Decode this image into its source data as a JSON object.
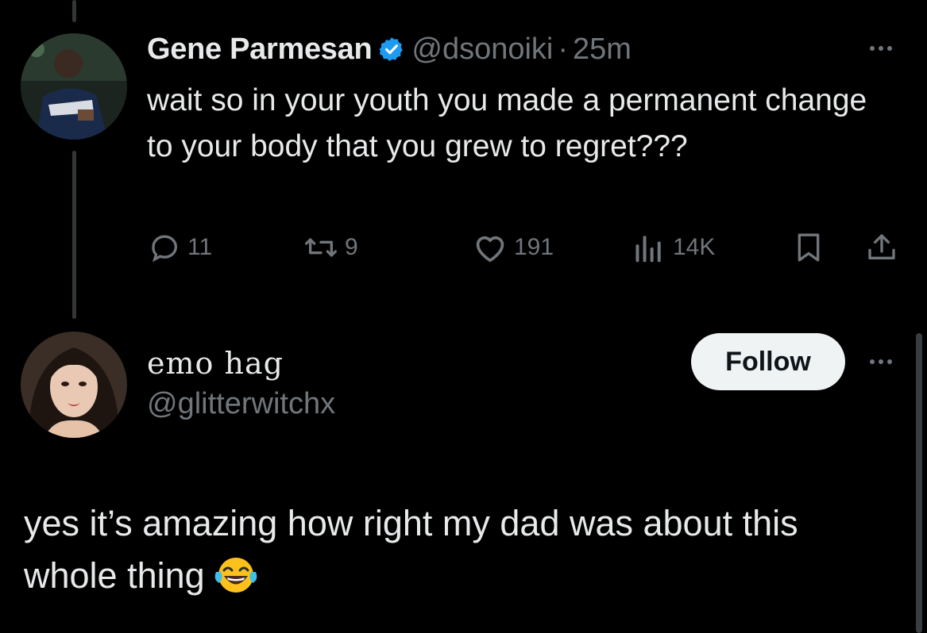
{
  "parent_tweet": {
    "display_name": "Gene Parmesan",
    "handle": "@dsonoiki",
    "separator": "·",
    "time": "25m",
    "text": "wait so in your youth you made a permanent change to your body that you grew to regret???",
    "actions": {
      "replies": "11",
      "retweets": "9",
      "likes": "191",
      "views": "14K"
    }
  },
  "reply": {
    "display_name": "emo hag",
    "handle": "@glitterwitchx",
    "follow_label": "Follow",
    "text": "yes it’s amazing how right my dad was about this whole thing"
  },
  "icons": {
    "verified": "verified-badge-icon",
    "reply": "reply-icon",
    "retweet": "retweet-icon",
    "like": "heart-icon",
    "views": "views-icon",
    "bookmark": "bookmark-icon",
    "share": "share-icon",
    "more": "more-icon",
    "emoji": "tears-of-joy-emoji-icon"
  },
  "colors": {
    "background": "#000000",
    "text": "#e7e9ea",
    "secondary": "#71767b",
    "verified": "#1d9bf0",
    "follow_bg": "#eff3f4"
  }
}
